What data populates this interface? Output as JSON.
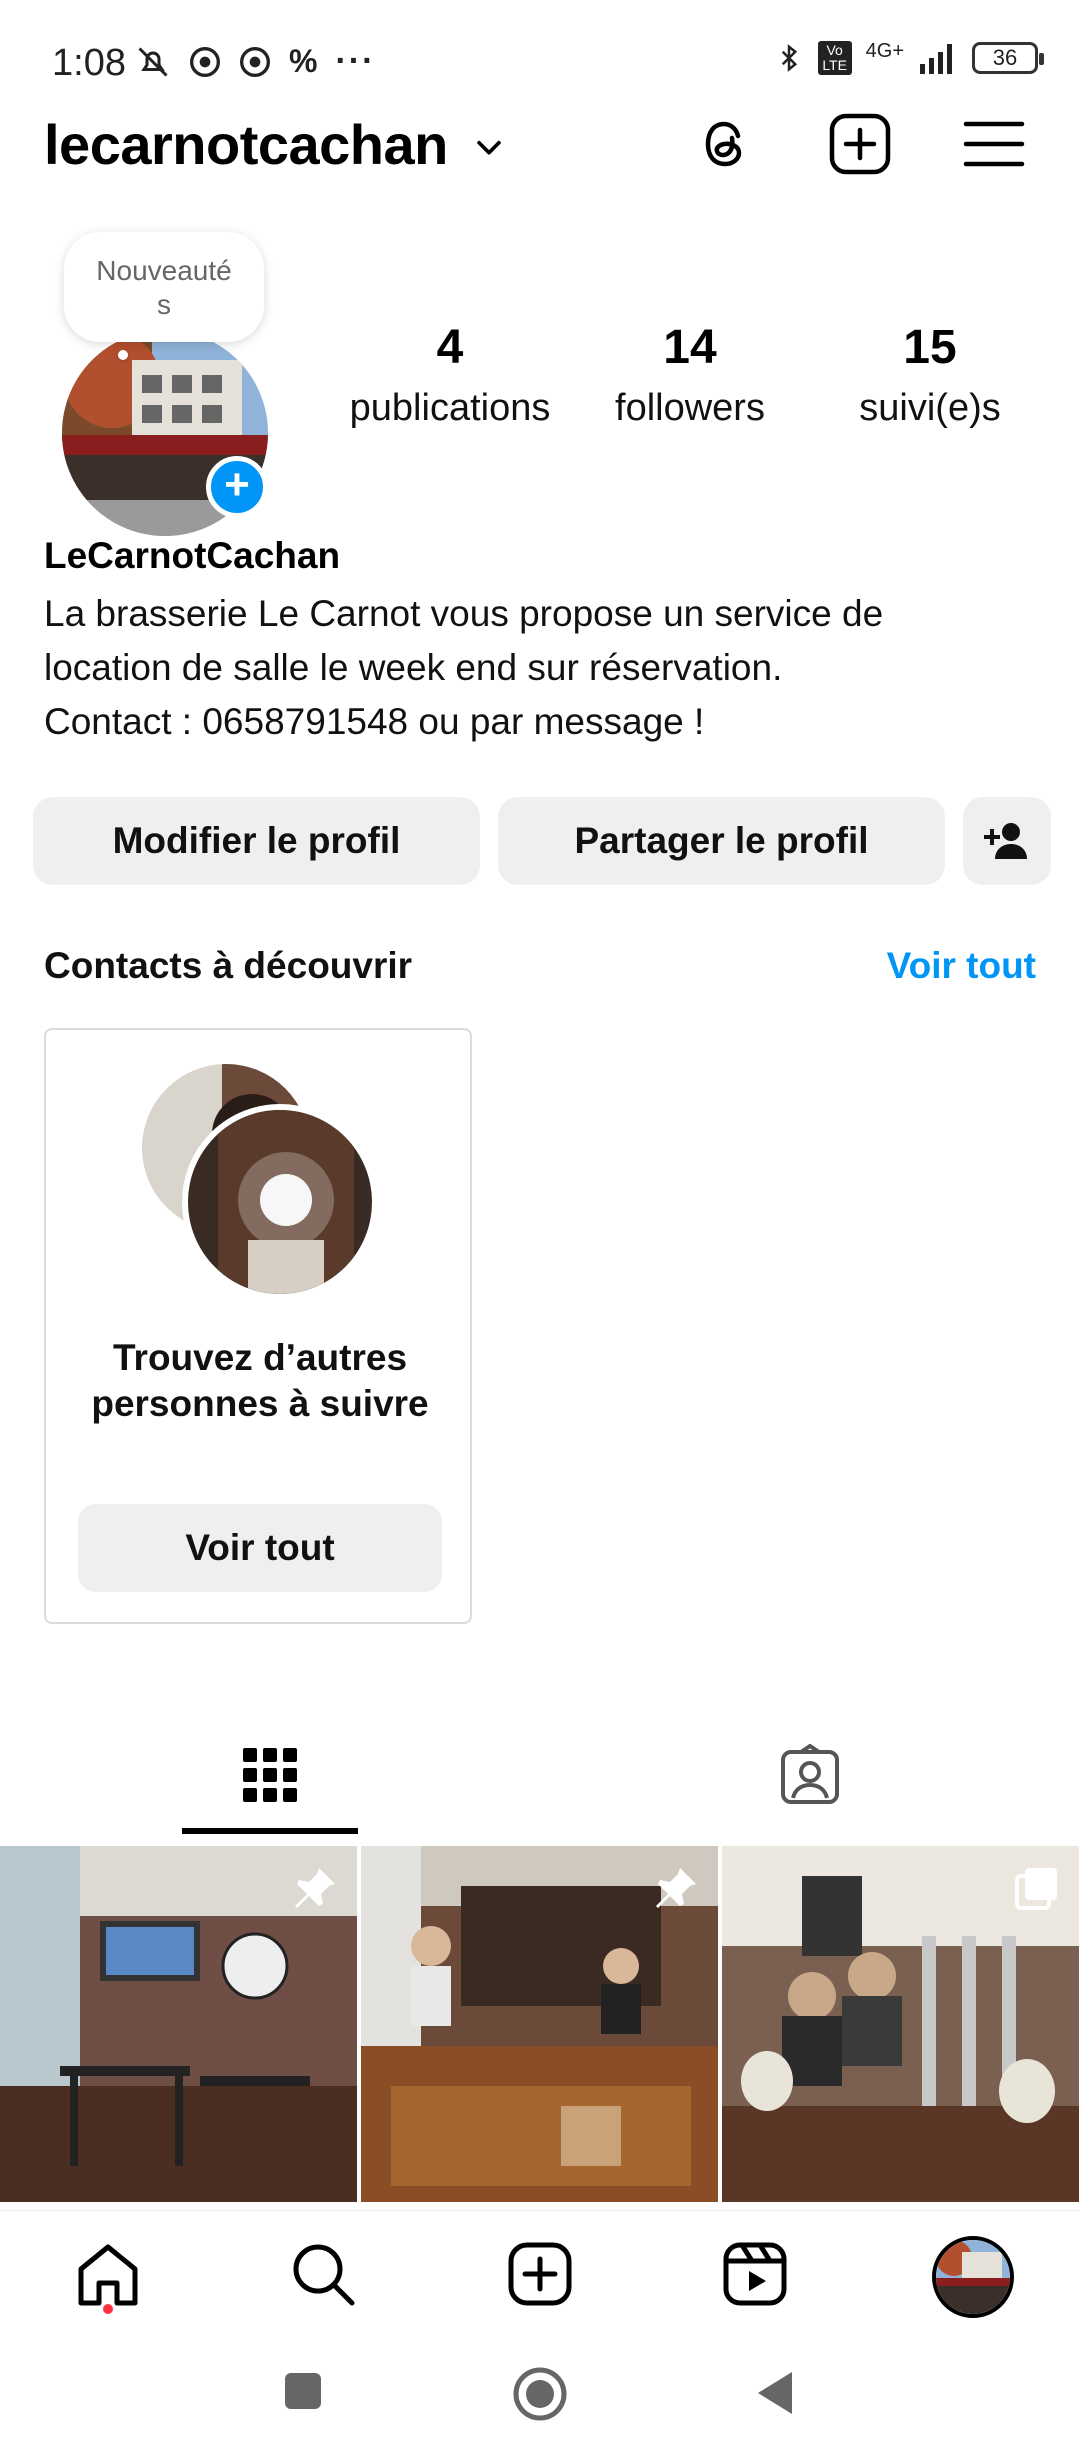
{
  "status_bar": {
    "time": "1:08",
    "left_icons": [
      "bell-off-icon",
      "chrome-icon",
      "chrome-icon",
      "percent-icon",
      "more-dots-icon"
    ],
    "network": "4G+",
    "volte": "Vo LTE",
    "battery": "36"
  },
  "header": {
    "username": "lecarnotcachan"
  },
  "profile": {
    "note": "Nouveauté\ns",
    "stats": [
      {
        "value": "4",
        "label": "publications"
      },
      {
        "value": "14",
        "label": "followers"
      },
      {
        "value": "15",
        "label": "suivi(e)s"
      }
    ],
    "display_name": "LeCarnotCachan",
    "bio_lines": [
      "La brasserie Le Carnot vous propose un service de",
      "location de salle le week end sur réservation.",
      "Contact : 0658791548 ou par message !"
    ]
  },
  "actions": {
    "edit_profile": "Modifier le profil",
    "share_profile": "Partager le profil"
  },
  "suggestions": {
    "title": "Contacts à découvrir",
    "see_all": "Voir tout",
    "card_text": "Trouvez d’autres personnes à suivre",
    "card_button": "Voir tout"
  },
  "tabs": [
    "grid-icon",
    "tagged-icon"
  ],
  "nav": [
    "home-icon",
    "search-icon",
    "create-icon",
    "reels-icon",
    "profile-avatar"
  ]
}
